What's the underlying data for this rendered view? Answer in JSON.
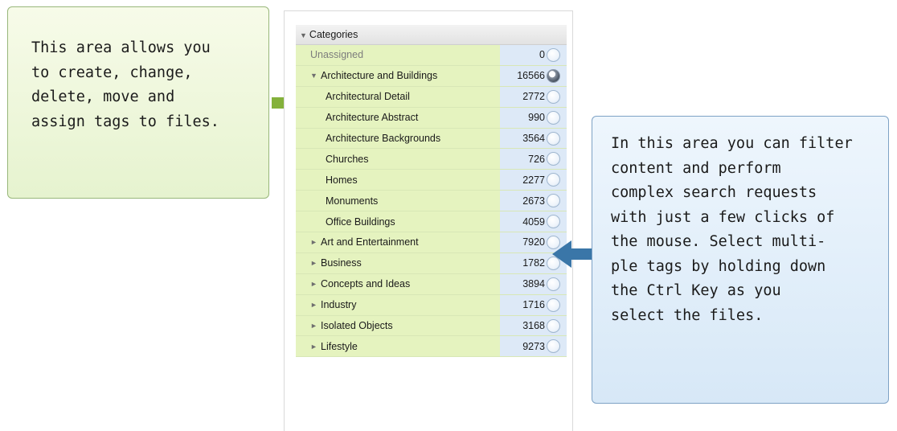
{
  "left_callout": {
    "lines": [
      "This area allows you",
      "to create, change,",
      "delete, move and",
      "assign tags to files."
    ]
  },
  "right_callout": {
    "lines": [
      "In this area you can filter",
      "content and perform",
      "complex search requests",
      "with just a few clicks of",
      "the mouse. Select multi-",
      "ple tags by holding down",
      "the Ctrl Key as you",
      "select the files."
    ]
  },
  "colors": {
    "green_arrow": "#84b13b",
    "blue_arrow": "#3a76a8",
    "name_column_bg": "#e5f3bf",
    "count_column_bg": "#dde9f7"
  },
  "categories": {
    "header": "Categories",
    "header_icon": "triangle-down-icon",
    "rows": [
      {
        "label": "Unassigned",
        "count": "0",
        "toggle": "",
        "muted": true,
        "selected": false
      },
      {
        "label": "Architecture and Buildings",
        "count": "16566",
        "toggle": "▼",
        "selected": true
      },
      {
        "label": "Architectural Detail",
        "count": "2772",
        "toggle": "",
        "selected": false
      },
      {
        "label": "Architecture Abstract",
        "count": "990",
        "toggle": "",
        "selected": false
      },
      {
        "label": "Architecture Backgrounds",
        "count": "3564",
        "toggle": "",
        "selected": false
      },
      {
        "label": "Churches",
        "count": "726",
        "toggle": "",
        "selected": false
      },
      {
        "label": "Homes",
        "count": "2277",
        "toggle": "",
        "selected": false
      },
      {
        "label": "Monuments",
        "count": "2673",
        "toggle": "",
        "selected": false
      },
      {
        "label": "Office Buildings",
        "count": "4059",
        "toggle": "",
        "selected": false
      },
      {
        "label": "Art and Entertainment",
        "count": "7920",
        "toggle": "►",
        "selected": false
      },
      {
        "label": "Business",
        "count": "1782",
        "toggle": "►",
        "selected": false
      },
      {
        "label": "Concepts and Ideas",
        "count": "3894",
        "toggle": "►",
        "selected": false
      },
      {
        "label": "Industry",
        "count": "1716",
        "toggle": "►",
        "selected": false
      },
      {
        "label": "Isolated Objects",
        "count": "3168",
        "toggle": "►",
        "selected": false
      },
      {
        "label": "Lifestyle",
        "count": "9273",
        "toggle": "►",
        "selected": false
      }
    ]
  }
}
